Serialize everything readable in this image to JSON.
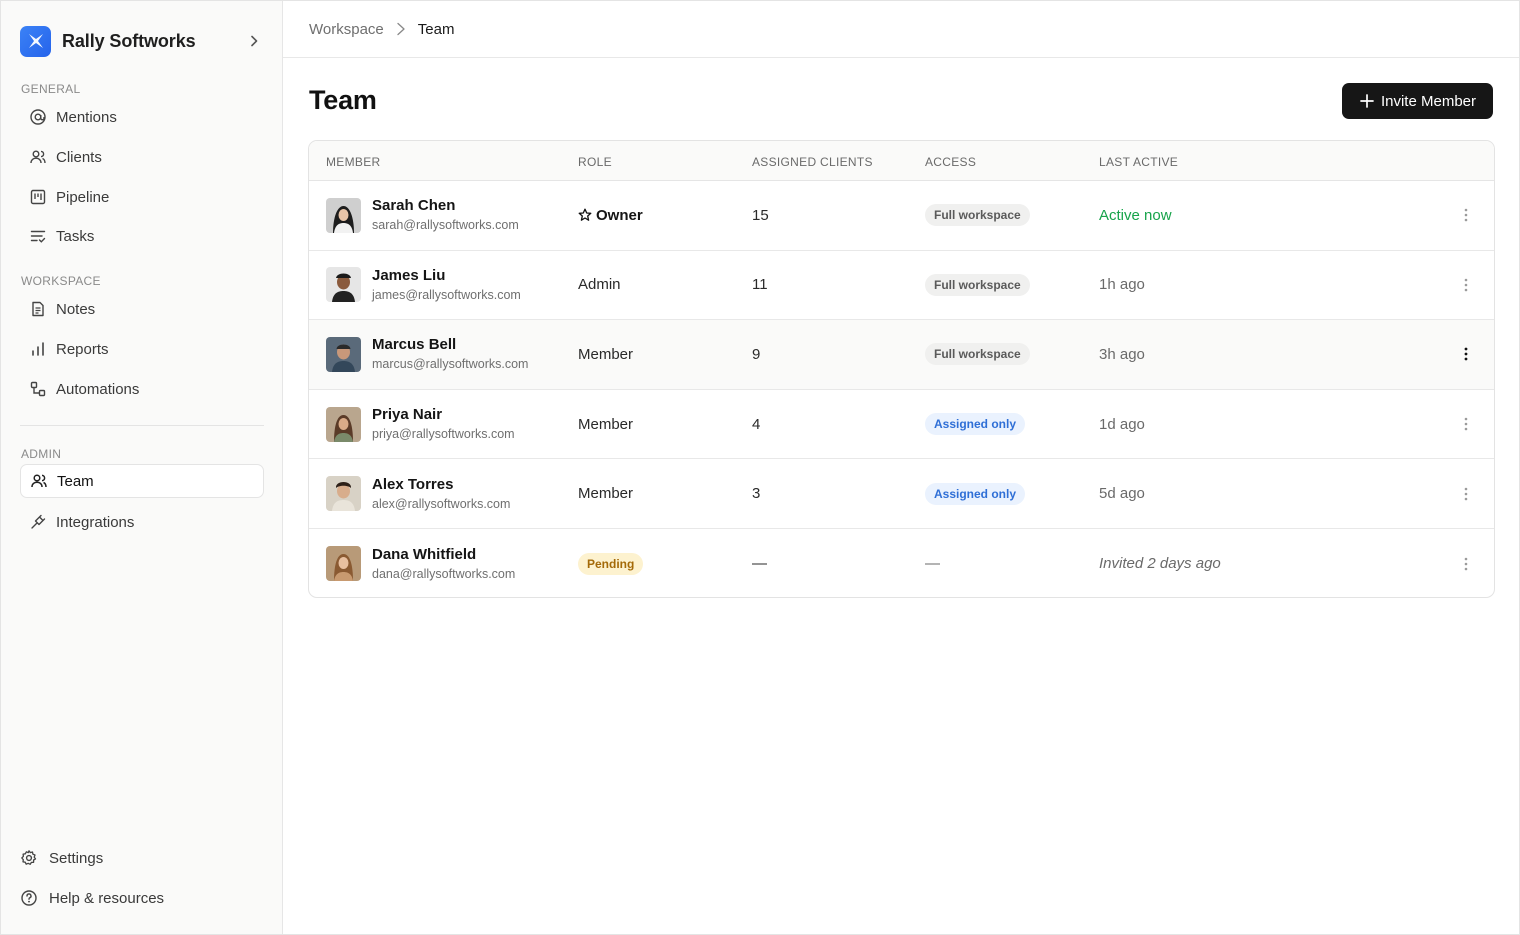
{
  "brand": {
    "name": "Rally Softworks",
    "accent": "#2563eb"
  },
  "sidebar": {
    "general_label": "GENERAL",
    "general_items": [
      {
        "label": "Mentions",
        "icon": "at-sign-icon"
      },
      {
        "label": "Clients",
        "icon": "users-icon"
      },
      {
        "label": "Pipeline",
        "icon": "kanban-icon"
      },
      {
        "label": "Tasks",
        "icon": "list-check-icon"
      }
    ],
    "workspace_label": "WORKSPACE",
    "workspace_items": [
      {
        "label": "Notes",
        "icon": "document-icon"
      },
      {
        "label": "Reports",
        "icon": "bar-chart-icon"
      },
      {
        "label": "Automations",
        "icon": "workflow-icon"
      }
    ],
    "admin_label": "ADMIN",
    "admin_items": [
      {
        "label": "Team",
        "icon": "users-icon",
        "active": true
      },
      {
        "label": "Integrations",
        "icon": "plug-icon"
      }
    ],
    "footer": [
      {
        "label": "Settings",
        "icon": "gear-icon"
      },
      {
        "label": "Help & resources",
        "icon": "help-circle-icon"
      }
    ]
  },
  "breadcrumb": {
    "root": "Workspace",
    "current": "Team"
  },
  "page": {
    "title": "Team",
    "invite_label": "Invite Member"
  },
  "table": {
    "columns": [
      "MEMBER",
      "ROLE",
      "ASSIGNED CLIENTS",
      "ACCESS",
      "LAST ACTIVE"
    ],
    "rows": [
      {
        "name": "Sarah Chen",
        "email": "sarah@rallysoftworks.com",
        "role": "Owner",
        "clients": "15",
        "access": "Full workspace",
        "last_active": "Active now"
      },
      {
        "name": "James Liu",
        "email": "james@rallysoftworks.com",
        "role": "Admin",
        "clients": "11",
        "access": "Full workspace",
        "last_active": "1h ago"
      },
      {
        "name": "Marcus Bell",
        "email": "marcus@rallysoftworks.com",
        "role": "Member",
        "clients": "9",
        "access": "Full workspace",
        "last_active": "3h ago"
      },
      {
        "name": "Priya Nair",
        "email": "priya@rallysoftworks.com",
        "role": "Member",
        "clients": "4",
        "access": "Assigned only",
        "last_active": "1d ago"
      },
      {
        "name": "Alex Torres",
        "email": "alex@rallysoftworks.com",
        "role": "Member",
        "clients": "3",
        "access": "Assigned only",
        "last_active": "5d ago"
      },
      {
        "name": "Dana Whitfield",
        "email": "dana@rallysoftworks.com",
        "role": "Pending",
        "clients": "—",
        "access": "—",
        "last_active": "Invited 2 days ago"
      }
    ]
  },
  "colors": {
    "active_green": "#17a34a",
    "assigned_blue": "#2f6fd6",
    "pending_amber": "#a46a08"
  }
}
